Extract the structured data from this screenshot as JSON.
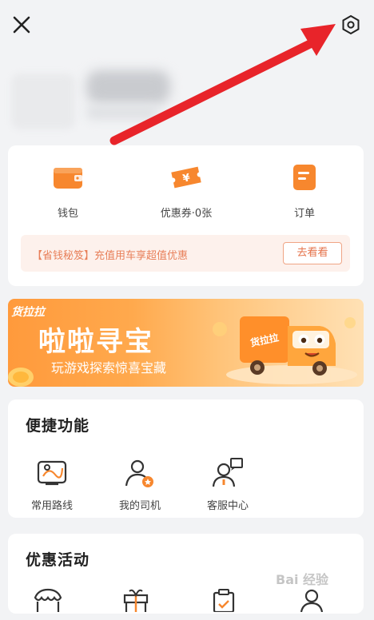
{
  "header": {
    "close_icon": "close-icon",
    "settings_icon": "settings-hexagon-icon"
  },
  "quick_links": [
    {
      "label": "钱包",
      "icon": "wallet-icon"
    },
    {
      "label": "优惠券·0张",
      "icon": "coupon-icon"
    },
    {
      "label": "订单",
      "icon": "order-icon"
    }
  ],
  "promo": {
    "text": "【省钱秘笈】充值用车享超值优惠",
    "button": "去看看"
  },
  "banner": {
    "brand": "货拉拉",
    "title": "啦啦寻宝",
    "subtitle": "玩游戏探索惊喜宝藏"
  },
  "shortcuts": {
    "title": "便捷功能",
    "items": [
      {
        "label": "常用路线",
        "icon": "route-map-icon"
      },
      {
        "label": "我的司机",
        "icon": "driver-icon"
      },
      {
        "label": "客服中心",
        "icon": "customer-service-icon"
      }
    ]
  },
  "activities": {
    "title": "优惠活动",
    "items": [
      {
        "icon": "store-icon"
      },
      {
        "icon": "gift-icon"
      },
      {
        "icon": "clipboard-icon"
      },
      {
        "icon": "person-icon"
      }
    ]
  },
  "watermark": "Bai 经验",
  "colors": {
    "accent": "#f7872e",
    "promo_text": "#e8805a",
    "arrow": "#e8242a"
  }
}
